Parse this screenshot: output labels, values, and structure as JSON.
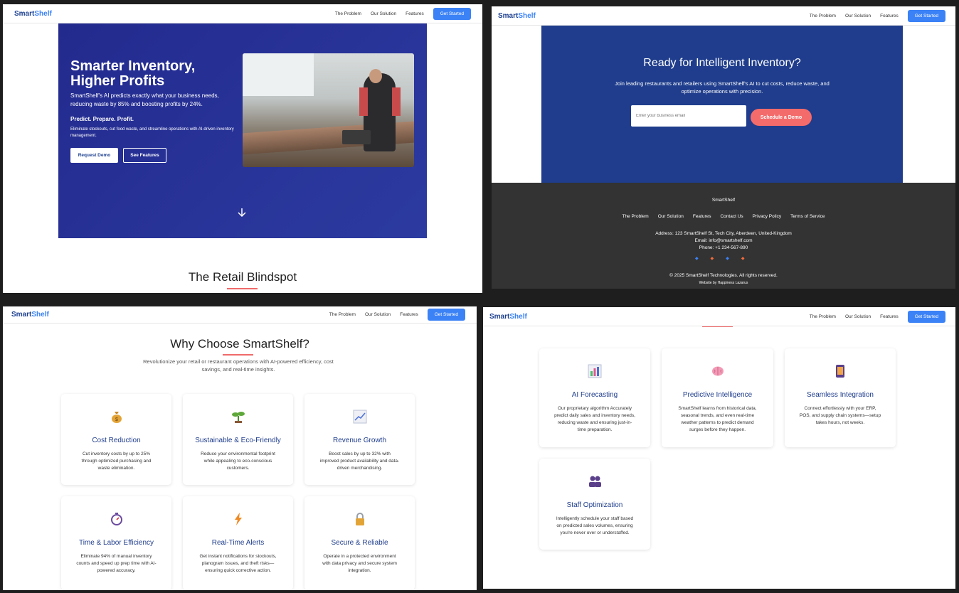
{
  "nav": {
    "logo_main": "Smart",
    "logo_accent": "Shelf",
    "links": [
      "The Problem",
      "Our Solution",
      "Features"
    ],
    "cta": "Get Started"
  },
  "hero": {
    "title": "Smarter Inventory, Higher Profits",
    "subtitle": "SmartShelf's AI predicts exactly what your business needs, reducing waste by 85% and boosting profits by 24%.",
    "tagline": "Predict. Prepare. Profit.",
    "description": "Eliminate stockouts, cut food waste, and streamline operations with AI-driven inventory management.",
    "primary_button": "Request Demo",
    "secondary_button": "See Features",
    "scroll_icon": "arrow-down-icon"
  },
  "problem_section": {
    "title": "The Retail Blindspot"
  },
  "cta": {
    "title": "Ready for Intelligent Inventory?",
    "subtitle": "Join leading restaurants and retailers using SmartShelf's AI to cut costs, reduce waste, and optimize operations with precision.",
    "email_placeholder": "Enter your business email",
    "button": "Schedule a Demo"
  },
  "footer": {
    "brand": "SmartShelf",
    "links": [
      "The Problem",
      "Our Solution",
      "Features",
      "Contact Us",
      "Privacy Policy",
      "Terms of Service"
    ],
    "address": "Address: 123 SmartShelf St, Tech City, Aberdeen, United-Kingdom",
    "email": "Email: info@smartshelf.com",
    "phone": "Phone: +1 234-567-890",
    "social_icons": [
      "facebook-icon",
      "twitter-icon",
      "linkedin-icon",
      "instagram-icon"
    ],
    "copyright": "© 2025 SmartShelf Technologies. All rights reserved.",
    "credit": "Website by Happiness Lazarus"
  },
  "why": {
    "title": "Why Choose SmartShelf?",
    "subtitle": "Revolutionize your retail or restaurant operations with AI-powered efficiency, cost savings, and real-time insights.",
    "cards": [
      {
        "icon": "money-bag-icon",
        "title": "Cost Reduction",
        "desc": "Cut inventory costs by up to 25% through optimized purchasing and waste elimination."
      },
      {
        "icon": "seedling-icon",
        "title": "Sustainable & Eco-Friendly",
        "desc": "Reduce your environmental footprint while appealing to eco-conscious customers."
      },
      {
        "icon": "chart-up-icon",
        "title": "Revenue Growth",
        "desc": "Boost sales by up to 32% with improved product availability and data-driven merchandising."
      },
      {
        "icon": "stopwatch-icon",
        "title": "Time & Labor Efficiency",
        "desc": "Eliminate 94% of manual inventory counts and speed up prep time with AI-powered accuracy."
      },
      {
        "icon": "lightning-icon",
        "title": "Real-Time Alerts",
        "desc": "Get instant notifications for stockouts, planogram issues, and theft risks—ensuring quick corrective action."
      },
      {
        "icon": "lock-icon",
        "title": "Secure & Reliable",
        "desc": "Operate in a protected environment with data privacy and secure system integration."
      }
    ]
  },
  "features": {
    "cards": [
      {
        "icon": "bar-chart-icon",
        "title": "AI Forecasting",
        "desc": "Our proprietary algorithm Accurately predict daily sales and inventory needs, reducing waste and ensuring just-in-time preparation."
      },
      {
        "icon": "brain-icon",
        "title": "Predictive Intelligence",
        "desc": "SmartShelf learns from historical data, seasonal trends, and even real-time weather patterns to predict demand surges before they happen."
      },
      {
        "icon": "phone-icon",
        "title": "Seamless Integration",
        "desc": "Connect effortlessly with your ERP, POS, and supply chain systems—setup takes hours, not weeks."
      },
      {
        "icon": "people-icon",
        "title": "Staff Optimization",
        "desc": "Intelligently schedule your staff based on predicted sales volumes, ensuring you're never over or understaffed."
      }
    ]
  }
}
